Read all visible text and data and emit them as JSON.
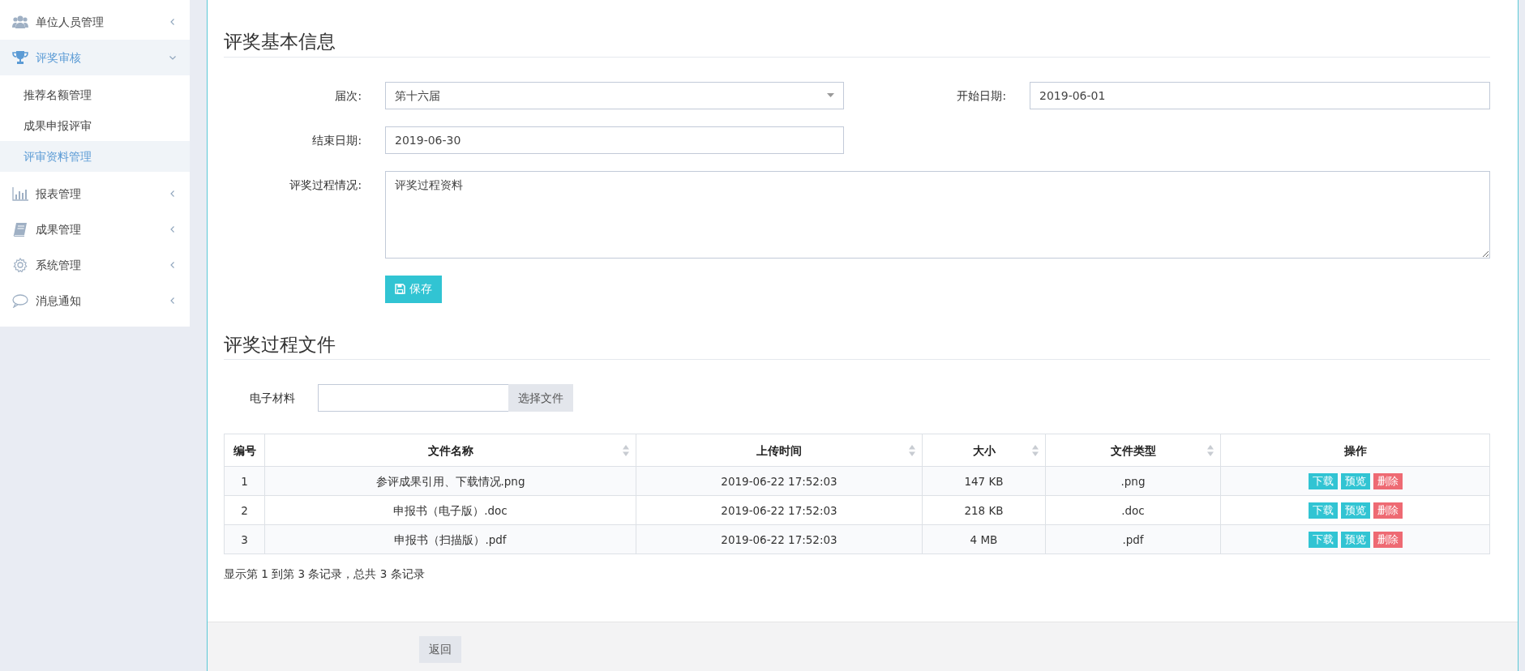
{
  "sidebar": {
    "items": [
      {
        "label": "单位人员管理",
        "kind": "users",
        "expanded": false,
        "selected": false
      },
      {
        "label": "评奖审核",
        "kind": "trophy",
        "expanded": true,
        "selected": true,
        "children": [
          {
            "label": "推荐名额管理",
            "selected": false
          },
          {
            "label": "成果申报评审",
            "selected": false
          },
          {
            "label": "评审资料管理",
            "selected": true
          }
        ]
      },
      {
        "label": "报表管理",
        "kind": "chart",
        "expanded": false,
        "selected": false
      },
      {
        "label": "成果管理",
        "kind": "book",
        "expanded": false,
        "selected": false
      },
      {
        "label": "系统管理",
        "kind": "gear",
        "expanded": false,
        "selected": false
      },
      {
        "label": "消息通知",
        "kind": "chat",
        "expanded": false,
        "selected": false
      }
    ]
  },
  "basic_info": {
    "title": "评奖基本信息",
    "session": {
      "label": "届次:",
      "value": "第十六届"
    },
    "start_date": {
      "label": "开始日期:",
      "value": "2019-06-01"
    },
    "end_date": {
      "label": "结束日期:",
      "value": "2019-06-30"
    },
    "process": {
      "label": "评奖过程情况:",
      "value": "评奖过程资料"
    },
    "save_button": "保存"
  },
  "process_files": {
    "title": "评奖过程文件",
    "upload": {
      "label": "电子材料",
      "button": "选择文件"
    },
    "table": {
      "columns": [
        {
          "label": "编号",
          "sortable": false
        },
        {
          "label": "文件名称",
          "sortable": true
        },
        {
          "label": "上传时间",
          "sortable": true
        },
        {
          "label": "大小",
          "sortable": true
        },
        {
          "label": "文件类型",
          "sortable": true
        },
        {
          "label": "操作",
          "sortable": false
        }
      ],
      "rows": [
        {
          "cells": [
            "1",
            "参评成果引用、下载情况.png",
            "2019-06-22 17:52:03",
            "147 KB",
            ".png"
          ],
          "actions": [
            {
              "kind": "download",
              "label": "下载"
            },
            {
              "kind": "preview",
              "label": "预览"
            },
            {
              "kind": "delete",
              "label": "删除"
            }
          ]
        },
        {
          "cells": [
            "2",
            "申报书（电子版）.doc",
            "2019-06-22 17:52:03",
            "218 KB",
            ".doc"
          ],
          "actions": [
            {
              "kind": "download",
              "label": "下载"
            },
            {
              "kind": "preview",
              "label": "预览"
            },
            {
              "kind": "delete",
              "label": "删除"
            }
          ]
        },
        {
          "cells": [
            "3",
            "申报书（扫描版）.pdf",
            "2019-06-22 17:52:03",
            "4 MB",
            ".pdf"
          ],
          "actions": [
            {
              "kind": "download",
              "label": "下载"
            },
            {
              "kind": "preview",
              "label": "预览"
            },
            {
              "kind": "delete",
              "label": "删除"
            }
          ]
        }
      ]
    },
    "summary": "显示第 1 到第 3 条记录，总共 3 条记录"
  },
  "footer": {
    "back_button": "返回"
  }
}
